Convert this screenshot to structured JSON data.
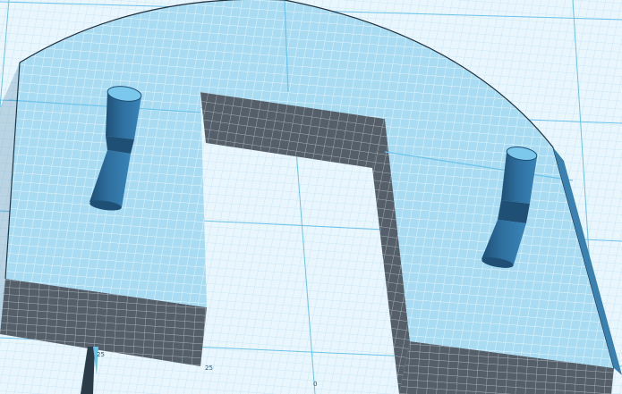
{
  "viewport": {
    "background": "#ffffff",
    "ground_plane_color": "#eaf6fd",
    "grid_minor_color": "#bfe3f6",
    "grid_major_color": "#6ec3ea",
    "model_top_color": "#a9dcf2",
    "model_top_grid_color": "#e8f7fd",
    "model_side_color": "#555f69",
    "model_side_grid_color": "#aab2ba",
    "model_edge_color": "#22303c",
    "peg_color": "#2e6f9e",
    "peg_dark_color": "#1f4f75",
    "peg_light_color": "#7cc7ec"
  },
  "scene": {
    "model_name": "u-shaped-plate",
    "pegs": [
      {
        "name": "left-peg"
      },
      {
        "name": "right-peg"
      }
    ]
  },
  "rulers": {
    "labels": [
      "25",
      "25",
      "0"
    ]
  }
}
